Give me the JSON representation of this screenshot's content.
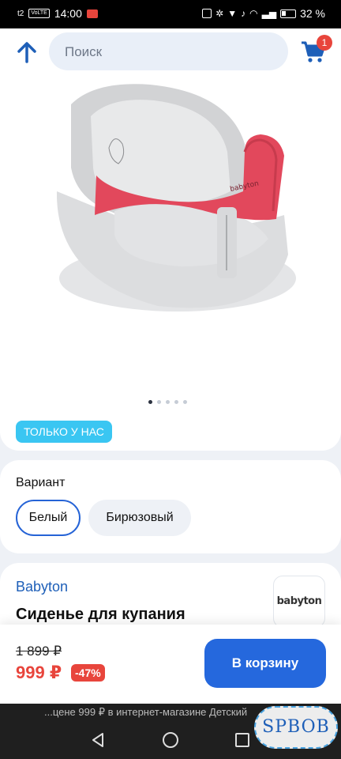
{
  "status_bar": {
    "carrier": "t2",
    "volte": "VoLTE",
    "time": "14:00",
    "battery": "32 %"
  },
  "header": {
    "search_placeholder": "Поиск",
    "cart_count": "1"
  },
  "product": {
    "image_logo_text": "babyton",
    "carousel_dots": 5,
    "active_dot": 0,
    "badge": "ТОЛЬКО У НАС"
  },
  "variants": {
    "title": "Вариант",
    "options": [
      "Белый",
      "Бирюзовый"
    ],
    "selected": "Белый"
  },
  "info": {
    "brand": "Babyton",
    "title": "Сиденье для купания",
    "logo_text": "babyton"
  },
  "purchase": {
    "old_price": "1 899 ₽",
    "price": "999 ₽",
    "discount": "-47%",
    "button": "В корзину"
  },
  "ticker": "...цене 999 ₽ в интернет-магазине Детский",
  "watermark": "SPBOB",
  "colors": {
    "accent": "#2568dd",
    "sale": "#e8453c",
    "badge": "#3ac6f2"
  }
}
